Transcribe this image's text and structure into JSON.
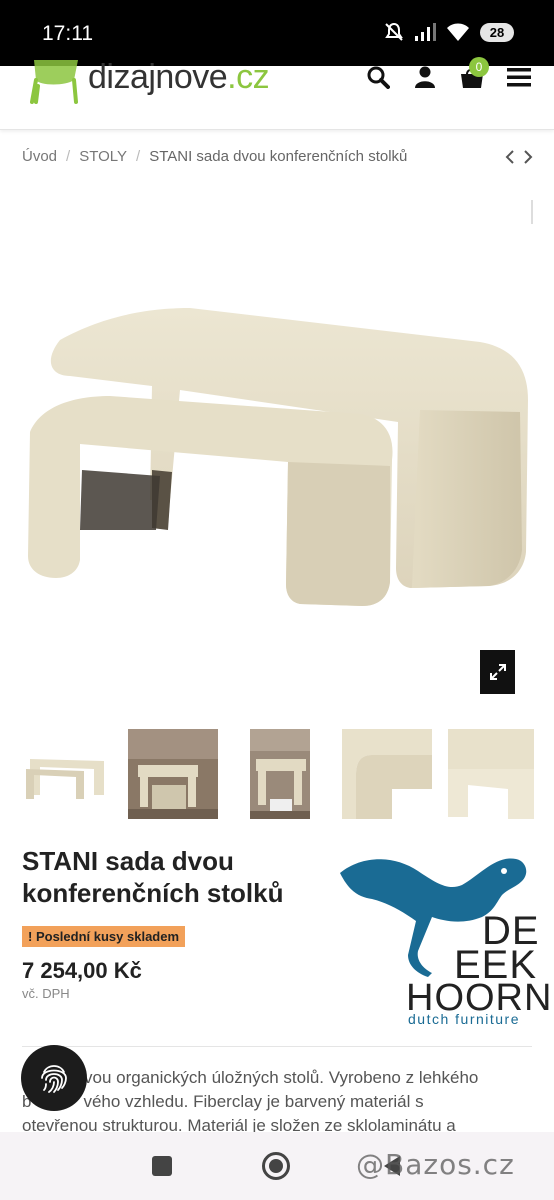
{
  "status_bar": {
    "time": "17:11",
    "battery": "28",
    "icons": [
      "mute-icon",
      "signal-icon",
      "wifi-icon",
      "battery-icon"
    ]
  },
  "header": {
    "logo_text": "dizajnove",
    "logo_tld": ".cz",
    "cart_count": "0",
    "accent_color": "#8cc63f",
    "icons": [
      "search-icon",
      "user-icon",
      "cart-icon",
      "menu-icon"
    ]
  },
  "breadcrumb": {
    "items": [
      "Úvod",
      "STOLY",
      "STANI sada dvou konferenčních stolků"
    ],
    "separator": "/"
  },
  "gallery": {
    "main_image": "cream nesting coffee tables",
    "thumbnail_count": 5
  },
  "product": {
    "title": "STANI sada dvou konferenčních stolků",
    "stock_icon": "!",
    "stock_label": "Poslední kusy skladem",
    "stock_color": "#f2a15a",
    "price": "7 254,00 Kč",
    "vat_note": "vč. DPH"
  },
  "brand": {
    "line1": "DE",
    "line2": "EEK",
    "line3": "HOORN",
    "tagline": "dutch furniture",
    "color": "#1a6b94"
  },
  "description": {
    "line1": "vou organických úložných stolů. Vyrobeno z lehkého",
    "line2_start": "b",
    "line2_end": "vého vzhledu. Fiberclay je barvený materiál s",
    "line3": "otevřenou strukturou. Materiál je složen ze sklolaminátu a"
  },
  "watermark": "@Bazos.cz"
}
